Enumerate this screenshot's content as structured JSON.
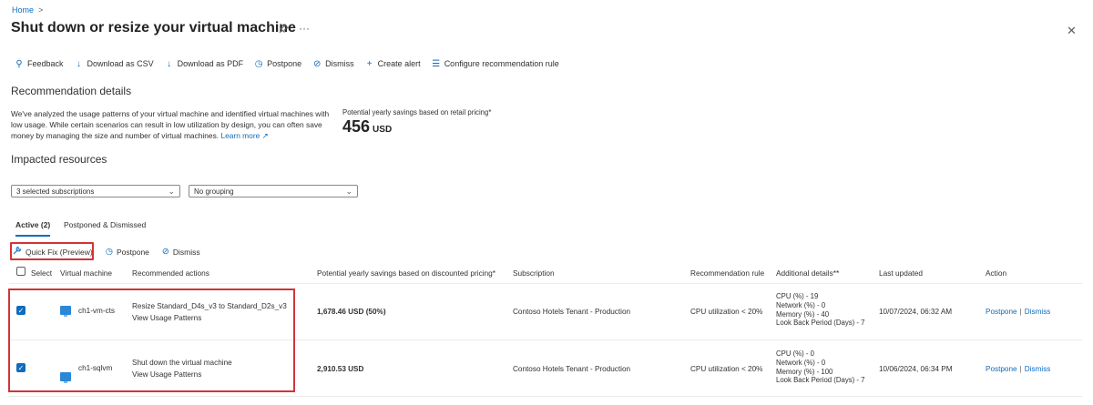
{
  "breadcrumb": {
    "home": "Home",
    "separator": ">"
  },
  "page": {
    "title": "Shut down or resize your virtual machine",
    "pin_icon": "pin-icon",
    "more": "···",
    "close": "✕"
  },
  "toolbar": [
    {
      "label": "Feedback",
      "icon": "feedback-icon",
      "glyph": "⚲"
    },
    {
      "label": "Download as CSV",
      "icon": "download-icon",
      "glyph": "↓"
    },
    {
      "label": "Download as PDF",
      "icon": "download-icon",
      "glyph": "↓"
    },
    {
      "label": "Postpone",
      "icon": "clock-icon",
      "glyph": "◷"
    },
    {
      "label": "Dismiss",
      "icon": "block-icon",
      "glyph": "⊘"
    },
    {
      "label": "Create alert",
      "icon": "plus-icon",
      "glyph": "+"
    },
    {
      "label": "Configure recommendation rule",
      "icon": "settings-sliders-icon",
      "glyph": "☰"
    }
  ],
  "recommendation": {
    "heading": "Recommendation details",
    "description": "We've analyzed the usage patterns of your virtual machine and identified virtual machines with low usage. While certain scenarios can result in low utilization by design, you can often save money by managing the size and number of virtual machines.",
    "learn_more": "Learn more",
    "savings_label": "Potential yearly savings based on retail pricing*",
    "savings_value": "456",
    "savings_unit": "USD"
  },
  "impacted": {
    "heading": "Impacted resources",
    "subscriptions_filter": "3 selected subscriptions",
    "grouping_filter": "No grouping"
  },
  "tabs": [
    {
      "label": "Active (2)",
      "active": true
    },
    {
      "label": "Postponed & Dismissed",
      "active": false
    }
  ],
  "actions": [
    {
      "label": "Quick Fix (Preview)",
      "icon": "wrench-icon",
      "glyph": "🔧"
    },
    {
      "label": "Postpone",
      "icon": "clock-icon",
      "glyph": "◷"
    },
    {
      "label": "Dismiss",
      "icon": "block-icon",
      "glyph": "⊘"
    }
  ],
  "table": {
    "headers": {
      "select": "Select",
      "vm": "Virtual machine",
      "recommended": "Recommended actions",
      "savings": "Potential yearly savings based on discounted pricing*",
      "subscription": "Subscription",
      "rule": "Recommendation rule",
      "details": "Additional details**",
      "updated": "Last updated",
      "action": "Action"
    },
    "rows": [
      {
        "checked": true,
        "vm": "ch1-vm-cts",
        "recommended_action": "Resize Standard_D4s_v3 to Standard_D2s_v3",
        "usage_link": "View Usage Patterns",
        "savings": "1,678.46 USD (50%)",
        "subscription": "Contoso Hotels Tenant - Production",
        "rule": "CPU utilization < 20%",
        "details": [
          "CPU (%) - 19",
          "Network (%) - 0",
          "Memory (%) - 40",
          "Look Back Period (Days) - 7"
        ],
        "updated": "10/07/2024, 06:32 AM",
        "postpone": "Postpone",
        "dismiss": "Dismiss"
      },
      {
        "checked": true,
        "vm": "ch1-sqlvm",
        "recommended_action": "Shut down the virtual machine",
        "usage_link": "View Usage Patterns",
        "savings": "2,910.53 USD",
        "subscription": "Contoso Hotels Tenant - Production",
        "rule": "CPU utilization < 20%",
        "details": [
          "CPU (%) - 0",
          "Network (%) - 0",
          "Memory (%) - 100",
          "Look Back Period (Days) - 7"
        ],
        "updated": "10/06/2024, 06:34 PM",
        "postpone": "Postpone",
        "dismiss": "Dismiss"
      }
    ]
  },
  "colors": {
    "accent": "#0f6cbd",
    "highlight": "#d13438",
    "text": "#323130"
  }
}
